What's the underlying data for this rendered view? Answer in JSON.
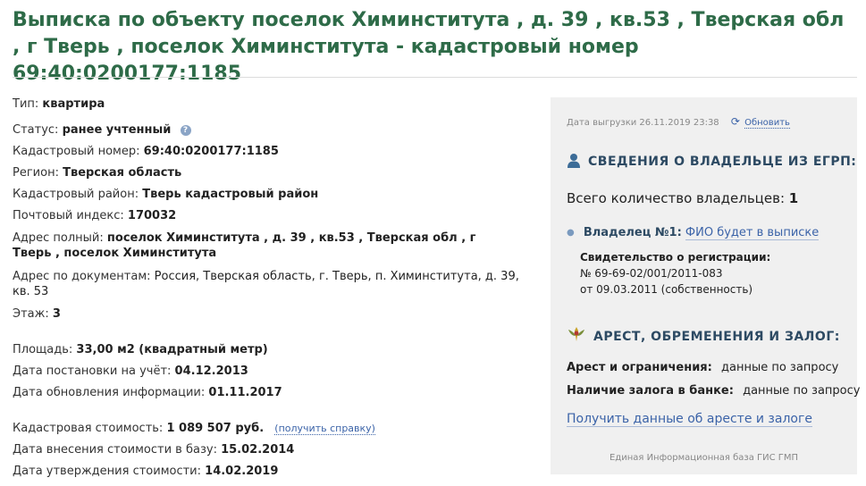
{
  "title": "Выписка по объекту поселок Химинститута , д. 39 , кв.53 , Тверская обл , г Тверь , поселок Химинститута - кадастровый номер 69:40:0200177:1185",
  "details": {
    "type": {
      "label": "Тип:",
      "value": "квартира"
    },
    "status": {
      "label": "Статус:",
      "value": "ранее учтенный",
      "help": "?"
    },
    "cadnum": {
      "label": "Кадастровый номер:",
      "value": "69:40:0200177:1185"
    },
    "region": {
      "label": "Регион:",
      "value": "Тверская область"
    },
    "district": {
      "label": "Кадастровый район:",
      "value": "Тверь кадастровый район"
    },
    "postcode": {
      "label": "Почтовый индекс:",
      "value": "170032"
    },
    "address_full": {
      "label": "Адрес полный:",
      "value": "поселок Химинститута , д. 39 , кв.53 , Тверская обл , г Тверь , поселок Химинститута"
    },
    "address_docs": {
      "label": "Адрес по документам:",
      "value": "Россия, Тверская область, г. Тверь, п. Химинститута, д. 39, кв. 53"
    },
    "floor": {
      "label": "Этаж:",
      "value": "3"
    },
    "area": {
      "label": "Площадь:",
      "value": "33,00 м2 (квадратный метр)"
    },
    "registered": {
      "label": "Дата постановки на учёт:",
      "value": "04.12.2013"
    },
    "updated": {
      "label": "Дата обновления информации:",
      "value": "01.11.2017"
    },
    "cost": {
      "label": "Кадастровая стоимость:",
      "value": "1 089 507 руб.",
      "link": "(получить справку)"
    },
    "cost_entered": {
      "label": "Дата внесения стоимости в базу:",
      "value": "15.02.2014"
    },
    "cost_approved": {
      "label": "Дата утверждения стоимости:",
      "value": "14.02.2019"
    }
  },
  "panel": {
    "export_date": "Дата выгрузки 26.11.2019 23:38",
    "refresh_label": "Обновить",
    "owner_section_title": "СВЕДЕНИЯ О ВЛАДЕЛЬЦЕ ИЗ ЕГРП:",
    "total_owners_label": "Всего количество владельцев:",
    "total_owners_value": "1",
    "owner_label": "Владелец №1:",
    "owner_link": "ФИО будет в выписке",
    "cert_title": "Свидетельство о регистрации:",
    "cert_number": "№ 69-69-02/001/2011-083",
    "cert_date": "от 09.03.2011 (собственность)",
    "arrest_section_title": "АРЕСТ, ОБРЕМЕНЕНИЯ И ЗАЛОГ:",
    "arrest_label": "Арест и ограничения:",
    "arrest_value": "данные по запросу",
    "pledge_label": "Наличие залога в банке:",
    "pledge_value": "данные по запросу",
    "arrest_link": "Получить данные об аресте и залоге",
    "footer": "Единая Информационная база ГИС ГМП"
  },
  "icons": {
    "owner": "person-icon",
    "arrest": "emblem-icon",
    "refresh": "refresh-icon",
    "help": "question-icon"
  },
  "colors": {
    "title": "#2e6b48",
    "link": "#3b63a8",
    "panel_bg": "#f0f0f0",
    "section_head": "#2d4a63"
  }
}
